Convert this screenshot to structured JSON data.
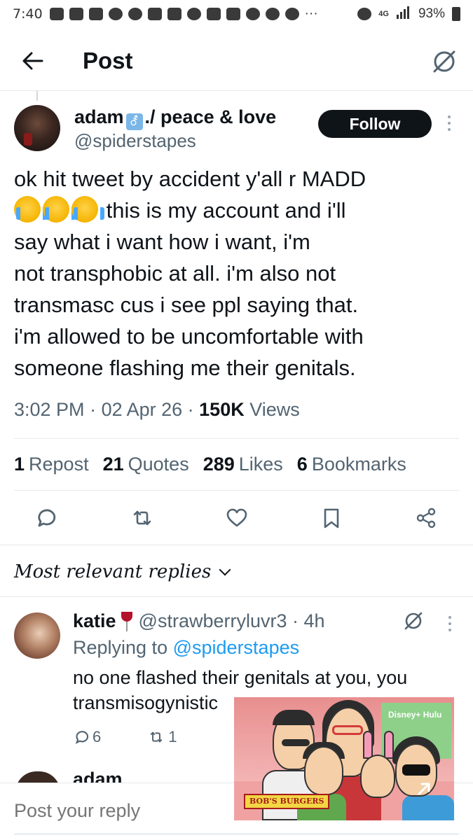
{
  "status_bar": {
    "time": "7:40",
    "network": "4G",
    "battery": "93%"
  },
  "header": {
    "title": "Post"
  },
  "tweet": {
    "author_name": "adam",
    "author_name_suffix": "./ peace & love",
    "handle": "@spiderstapes",
    "follow_label": "Follow",
    "text_lines": [
      "ok hit tweet by accident y'all r MADD",
      " this is my account and i'll",
      "say what i want how i want, i'm",
      "not transphobic at all. i'm also not",
      "transmasc cus i see ppl saying that.",
      "i'm allowed to be uncomfortable with",
      "someone flashing me their genitals."
    ],
    "time": "3:02 PM",
    "date": "02 Apr 26",
    "views_count": "150K",
    "views_label": "Views"
  },
  "stats": {
    "reposts": {
      "count": "1",
      "label": "Repost"
    },
    "quotes": {
      "count": "21",
      "label": "Quotes"
    },
    "likes": {
      "count": "289",
      "label": "Likes"
    },
    "bookmarks": {
      "count": "6",
      "label": "Bookmarks"
    }
  },
  "actions": [
    "reply-icon",
    "repost-icon",
    "like-icon",
    "bookmark-icon",
    "share-icon"
  ],
  "replies_sort": {
    "label": "Most relevant replies"
  },
  "reply": {
    "name": "katie",
    "handle": "@strawberryluvr3",
    "age": "4h",
    "replying_prefix": "Replying to",
    "replying_to": "@spiderstapes",
    "text_line1": "no one flashed their genitals at you, you",
    "text_line2": "transmisogynistic",
    "reply_count": "6",
    "repost_count": "1"
  },
  "next_reply": {
    "name": "adam"
  },
  "compose": {
    "placeholder": "Post your reply"
  },
  "pip": {
    "channel": "Disney+ Hulu",
    "show_logo": "BOB'S BURGERS"
  },
  "colors": {
    "text": "#0f1419",
    "muted": "#536471",
    "link": "#1d9bf0",
    "follow_bg": "#0f1419"
  }
}
